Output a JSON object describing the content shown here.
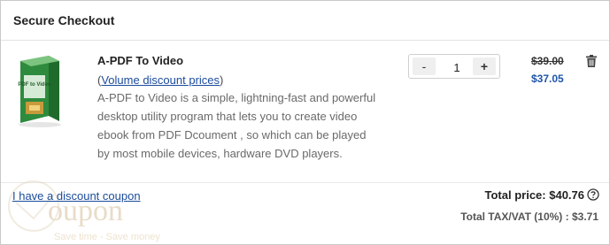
{
  "header": {
    "title": "Secure Checkout"
  },
  "product": {
    "name": "A-PDF To Video",
    "volume_open": "(",
    "volume_link": "Volume discount prices",
    "volume_close": ")",
    "description": "A-PDF to Video is a simple, lightning-fast and powerful desktop utility program that lets you to create video ebook from PDF Dcoument , so which can be played by most mobile devices, hardware DVD players.",
    "box_label": "PDF to Video",
    "price_old": "$39.00",
    "price_new": "$37.05"
  },
  "quantity": {
    "minus": "-",
    "value": "1",
    "plus": "+"
  },
  "coupon": {
    "link": "I have a discount coupon"
  },
  "watermark": {
    "text": "oupon",
    "tagline": "Save time - Save money"
  },
  "totals": {
    "total_price": "Total price: $40.76",
    "tax": "Total TAX/VAT (10%) : $3.71"
  },
  "icons": {
    "trash": "trash-icon",
    "help": "help-circle-icon"
  },
  "colors": {
    "link": "#1a4b9c",
    "new_price": "#1f55a8",
    "border": "#c9c9c9"
  }
}
